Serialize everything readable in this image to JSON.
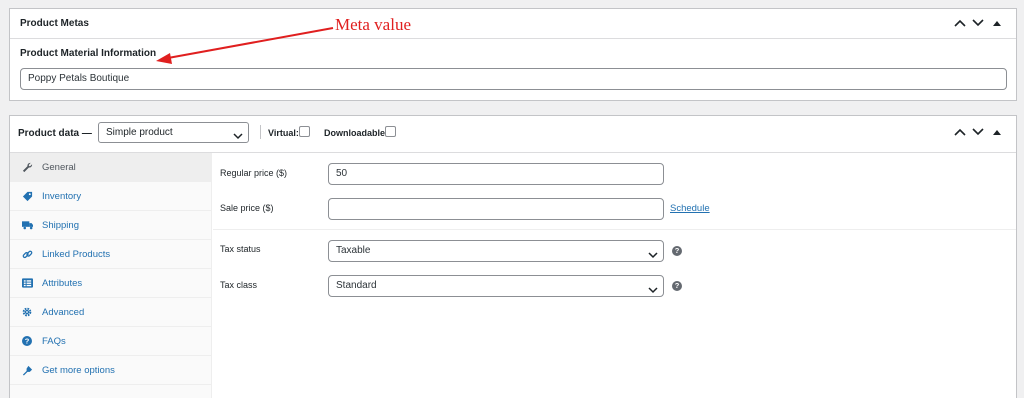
{
  "meta_box": {
    "title": "Product Metas",
    "field_label": "Product Material Information",
    "field_value": "Poppy Petals Boutique"
  },
  "annotation": {
    "text": "Meta value",
    "color": "#e01f1f"
  },
  "product_data": {
    "title": "Product data —",
    "product_type": "Simple product",
    "virtual_label": "Virtual:",
    "downloadable_label": "Downloadable:",
    "tabs": [
      {
        "label": "General",
        "icon": "wrench-icon"
      },
      {
        "label": "Inventory",
        "icon": "tag-icon"
      },
      {
        "label": "Shipping",
        "icon": "truck-icon"
      },
      {
        "label": "Linked Products",
        "icon": "link-icon"
      },
      {
        "label": "Attributes",
        "icon": "list-icon"
      },
      {
        "label": "Advanced",
        "icon": "gear-icon"
      },
      {
        "label": "FAQs",
        "icon": "question-icon"
      },
      {
        "label": "Get more options",
        "icon": "plugin-icon"
      }
    ],
    "general": {
      "regular_price_label": "Regular price ($)",
      "regular_price_value": "50",
      "sale_price_label": "Sale price ($)",
      "sale_price_value": "",
      "schedule_link": "Schedule",
      "tax_status_label": "Tax status",
      "tax_status_value": "Taxable",
      "tax_class_label": "Tax class",
      "tax_class_value": "Standard",
      "help_glyph": "?"
    }
  },
  "colors": {
    "link": "#2271b1",
    "border": "#c3c4c7"
  }
}
